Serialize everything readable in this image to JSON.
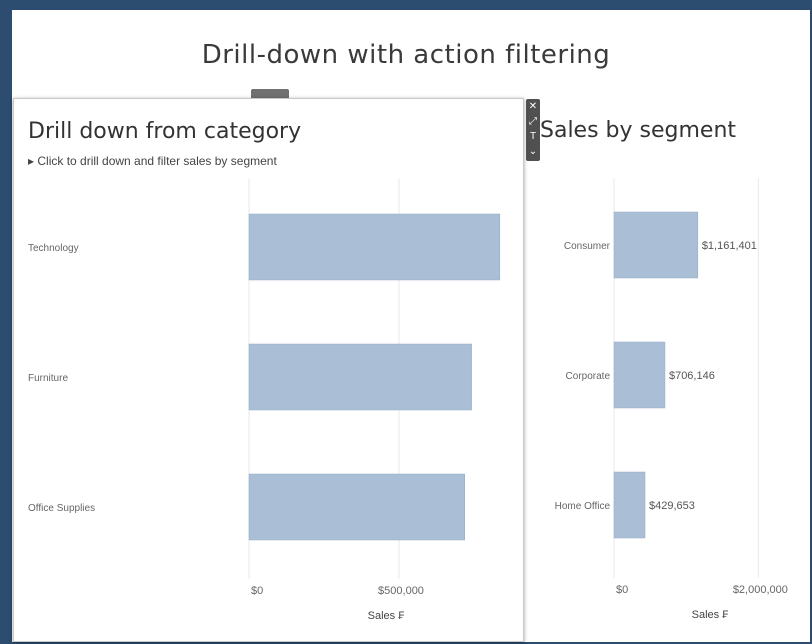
{
  "dashboard": {
    "title": "Drill-down with action filtering"
  },
  "left_panel": {
    "title": "Drill down from category",
    "subtitle": "▸ Click to drill down and filter sales by segment"
  },
  "right_panel": {
    "title": "Sales by segment"
  },
  "toolbar": {
    "icons": [
      "close-icon",
      "expand-icon",
      "filter-icon",
      "more-icon"
    ],
    "glyphs": [
      "✕",
      "⤢",
      "T",
      "⌄"
    ]
  },
  "colors": {
    "bar": "#aabfd6",
    "grid": "#e8e8e8",
    "background_frame": "#2c4c70"
  },
  "chart_data": [
    {
      "type": "bar",
      "orientation": "horizontal",
      "title": "Drill down from category",
      "categories": [
        "Technology",
        "Furniture",
        "Office Supplies"
      ],
      "values": [
        836154,
        741999,
        719047
      ],
      "xlabel": "Sales ₣",
      "xlim": [
        0,
        1000000
      ],
      "xticks": [
        0,
        500000
      ],
      "xtick_labels": [
        "$0",
        "$500,000"
      ],
      "grid": true
    },
    {
      "type": "bar",
      "orientation": "horizontal",
      "title": "Sales by segment",
      "categories": [
        "Consumer",
        "Corporate",
        "Home Office"
      ],
      "values": [
        1161401,
        706146,
        429653
      ],
      "data_labels": [
        "$1,161,401",
        "$706,146",
        "$429,653"
      ],
      "xlabel": "Sales ₣",
      "xlim": [
        0,
        2300000
      ],
      "xticks": [
        0,
        2000000
      ],
      "xtick_labels": [
        "$0",
        "$2,000,000"
      ],
      "grid": true
    }
  ]
}
